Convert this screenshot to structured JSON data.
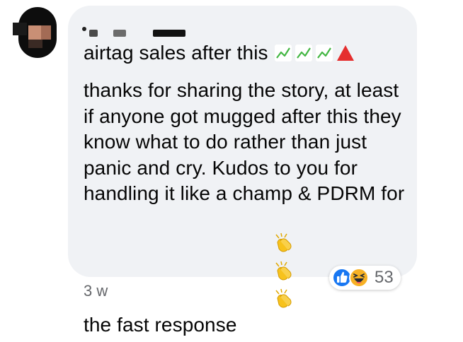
{
  "comment": {
    "line1_text": "airtag sales after this",
    "line1_emojis": [
      "chart-increasing-icon",
      "chart-increasing-icon",
      "chart-increasing-icon",
      "red-triangle-up-icon"
    ],
    "body_text": "thanks for sharing the story, at least if anyone got mugged after this they know what to do rather than just panic and cry. Kudos to you for handling it like a champ & PDRM for the fast response",
    "body_emojis": [
      "clapping-hands-icon",
      "clapping-hands-icon",
      "clapping-hands-icon"
    ]
  },
  "reactions": {
    "types": [
      "like-icon",
      "haha-icon"
    ],
    "count": "53"
  },
  "meta": {
    "timestamp": "3 w"
  },
  "colors": {
    "bubble_bg": "#f0f2f5",
    "text": "#050505",
    "secondary_text": "#65676b",
    "like_blue": "#1877f2"
  }
}
